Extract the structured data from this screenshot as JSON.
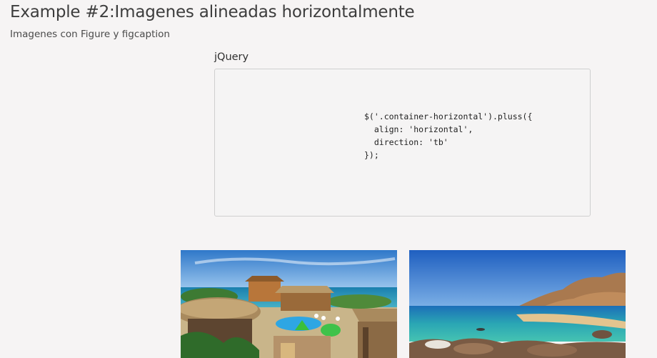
{
  "header": {
    "title": "Example #2:Imagenes alineadas horizontalmente",
    "subtitle": "Imagenes con Figure y figcaption"
  },
  "code_section": {
    "label": "jQuery",
    "code": "$('.container-horizontal').pluss({\n  align: 'horizontal',\n  direction: 'tb'\n});"
  },
  "gallery": {
    "images": [
      {
        "subject": "beach-resort-with-thatched-huts-and-pool"
      },
      {
        "subject": "rocky-bay-with-turquoise-water"
      }
    ]
  }
}
